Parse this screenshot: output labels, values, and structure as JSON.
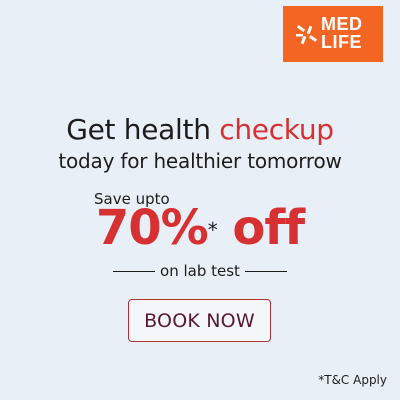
{
  "brand": {
    "logo_line1": "MED",
    "logo_line2": "LIFE",
    "logo_color": "#f26522",
    "logo_icon": "pinwheel-icon"
  },
  "headline": {
    "part1": "Get health ",
    "accent": "checkup",
    "subline": "today for healthier tomorrow"
  },
  "offer": {
    "save_upto": "Save upto",
    "amount": "70%",
    "asterisk": "*",
    "suffix": " off",
    "detail": "on lab test"
  },
  "cta": {
    "label": "BOOK NOW"
  },
  "terms": {
    "text": "*T&C Apply"
  },
  "colors": {
    "background": "#e9eff7",
    "accent_red": "#d63032",
    "text_dark": "#1d1d1d",
    "button_border": "#b03037"
  }
}
